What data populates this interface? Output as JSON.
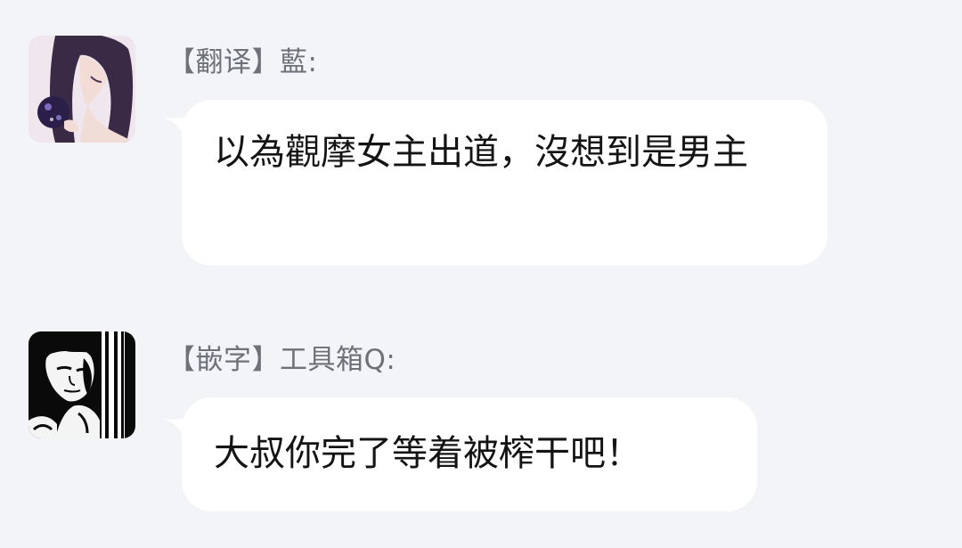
{
  "messages": [
    {
      "sender": "【翻译】藍:",
      "text": "以為觀摩女主出道，沒想到是男主",
      "avatar": "anime-girl-avatar"
    },
    {
      "sender": "【嵌字】工具箱Q:",
      "text": "大叔你完了等着被榨干吧！",
      "avatar": "bw-man-portrait-avatar"
    }
  ],
  "colors": {
    "background": "#f3f4f8",
    "bubble": "#ffffff",
    "sender_text": "#6f7178",
    "message_text": "#141414"
  }
}
